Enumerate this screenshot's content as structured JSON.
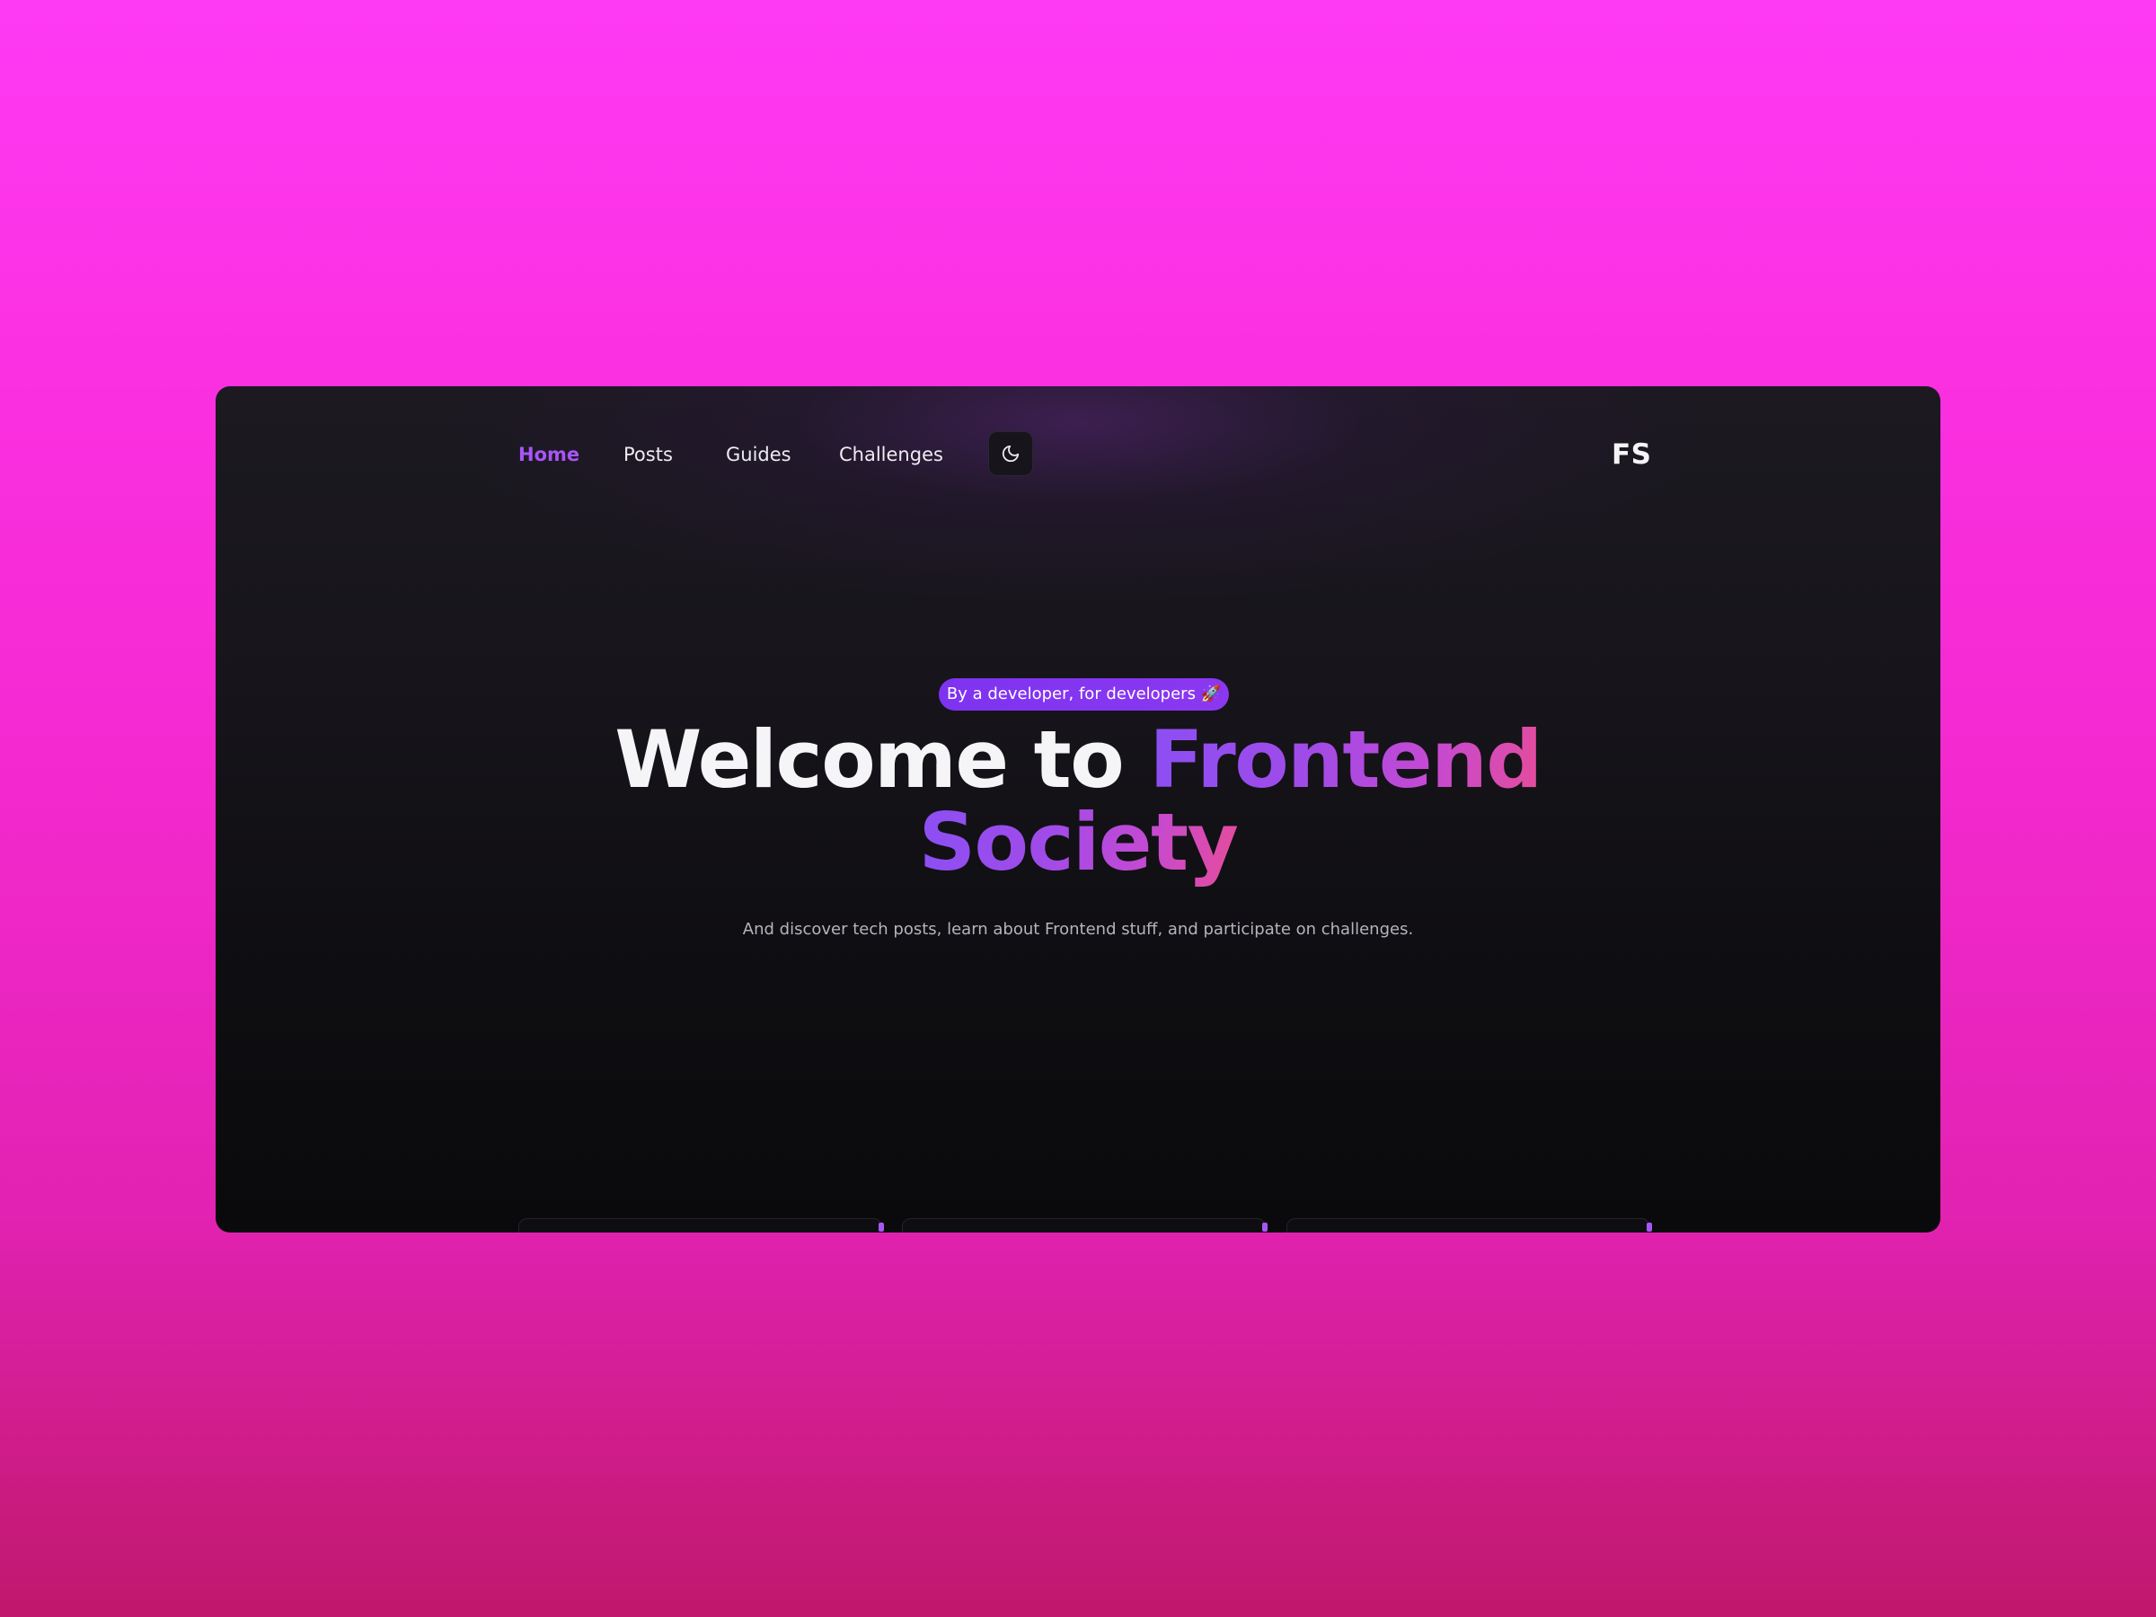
{
  "nav": {
    "items": [
      {
        "label": "Home",
        "active": true
      },
      {
        "label": "Posts",
        "active": false
      },
      {
        "label": "Guides",
        "active": false
      },
      {
        "label": "Challenges",
        "active": false
      }
    ],
    "theme_toggle_icon": "moon-icon",
    "logo": "FS"
  },
  "hero": {
    "badge": "By a developer, for developers 🚀",
    "headline_plain": "Welcome to ",
    "headline_highlight_1": "Frontend",
    "headline_highlight_2": "Society",
    "subtitle": "And discover tech posts, learn about Frontend stuff, and participate on challenges."
  },
  "colors": {
    "accent": "#a855f7",
    "badge_bg": "#7e33f0",
    "gradient_start": "#8b4ff4",
    "gradient_end": "#e64c9a",
    "page_bg_top": "#ff3af4",
    "page_bg_bottom": "#c0186c",
    "window_bg": "#0f0e12"
  }
}
